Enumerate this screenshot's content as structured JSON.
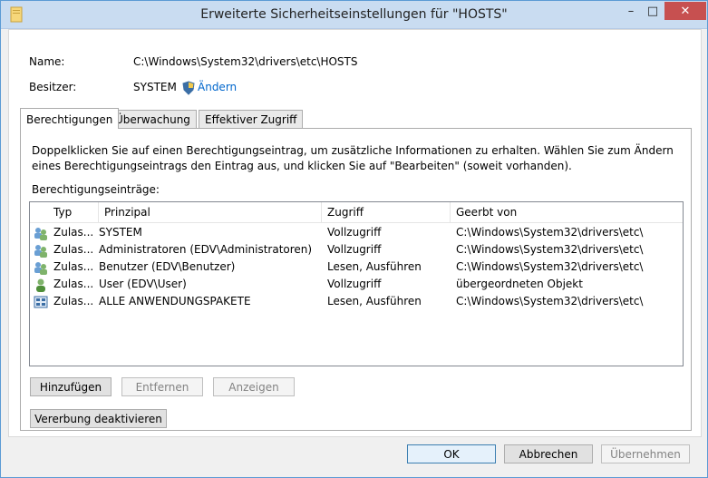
{
  "window": {
    "title": "Erweiterte Sicherheitseinstellungen für \"HOSTS\"",
    "minimize": "–",
    "maximize": "□",
    "close": "✕"
  },
  "info": {
    "name_label": "Name:",
    "name_value": "C:\\Windows\\System32\\drivers\\etc\\HOSTS",
    "owner_label": "Besitzer:",
    "owner_value": "SYSTEM",
    "change_link": "Ändern"
  },
  "tabs": [
    {
      "label": "Berechtigungen",
      "active": true
    },
    {
      "label": "Überwachung",
      "active": false
    },
    {
      "label": "Effektiver Zugriff",
      "active": false
    }
  ],
  "permissions": {
    "description": "Doppelklicken Sie auf einen Berechtigungseintrag, um zusätzliche Informationen zu erhalten. Wählen Sie zum Ändern eines Berechtigungseintrags den Eintrag aus, und klicken Sie auf \"Bearbeiten\" (soweit vorhanden).",
    "list_label": "Berechtigungseinträge:",
    "columns": [
      "Typ",
      "Prinzipal",
      "Zugriff",
      "Geerbt von"
    ],
    "rows": [
      {
        "icon": "group-users-icon",
        "type": "Zulas...",
        "principal": "SYSTEM",
        "access": "Vollzugriff",
        "inherited": "C:\\Windows\\System32\\drivers\\etc\\"
      },
      {
        "icon": "group-users-icon",
        "type": "Zulas...",
        "principal": "Administratoren (EDV\\Administratoren)",
        "access": "Vollzugriff",
        "inherited": "C:\\Windows\\System32\\drivers\\etc\\"
      },
      {
        "icon": "group-users-icon",
        "type": "Zulas...",
        "principal": "Benutzer (EDV\\Benutzer)",
        "access": "Lesen, Ausführen",
        "inherited": "C:\\Windows\\System32\\drivers\\etc\\"
      },
      {
        "icon": "single-user-icon",
        "type": "Zulas...",
        "principal": "User (EDV\\User)",
        "access": "Vollzugriff",
        "inherited": "übergeordneten Objekt"
      },
      {
        "icon": "app-package-icon",
        "type": "Zulas...",
        "principal": "ALLE ANWENDUNGSPAKETE",
        "access": "Lesen, Ausführen",
        "inherited": "C:\\Windows\\System32\\drivers\\etc\\"
      }
    ]
  },
  "buttons": {
    "add": "Hinzufügen",
    "remove": "Entfernen",
    "view": "Anzeigen",
    "disable_inheritance": "Vererbung deaktivieren",
    "ok": "OK",
    "cancel": "Abbrechen",
    "apply": "Übernehmen"
  },
  "colors": {
    "titlebar": "#c9dcf1",
    "close": "#c75050",
    "link": "#0066cc"
  }
}
